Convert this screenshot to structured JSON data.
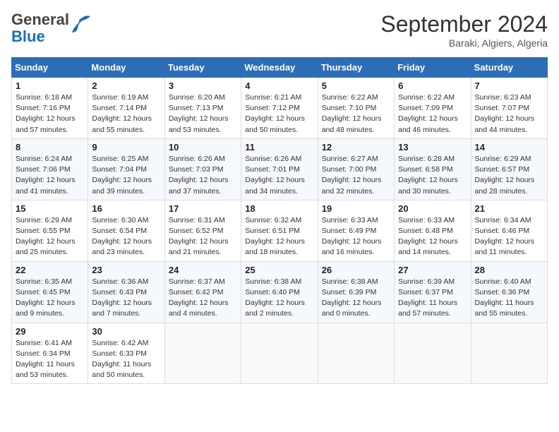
{
  "header": {
    "logo_general": "General",
    "logo_blue": "Blue",
    "month": "September 2024",
    "location": "Baraki, Algiers, Algeria"
  },
  "days_of_week": [
    "Sunday",
    "Monday",
    "Tuesday",
    "Wednesday",
    "Thursday",
    "Friday",
    "Saturday"
  ],
  "weeks": [
    [
      {
        "day": "1",
        "sunrise": "6:18 AM",
        "sunset": "7:16 PM",
        "daylight": "12 hours and 57 minutes."
      },
      {
        "day": "2",
        "sunrise": "6:19 AM",
        "sunset": "7:14 PM",
        "daylight": "12 hours and 55 minutes."
      },
      {
        "day": "3",
        "sunrise": "6:20 AM",
        "sunset": "7:13 PM",
        "daylight": "12 hours and 53 minutes."
      },
      {
        "day": "4",
        "sunrise": "6:21 AM",
        "sunset": "7:12 PM",
        "daylight": "12 hours and 50 minutes."
      },
      {
        "day": "5",
        "sunrise": "6:22 AM",
        "sunset": "7:10 PM",
        "daylight": "12 hours and 48 minutes."
      },
      {
        "day": "6",
        "sunrise": "6:22 AM",
        "sunset": "7:09 PM",
        "daylight": "12 hours and 46 minutes."
      },
      {
        "day": "7",
        "sunrise": "6:23 AM",
        "sunset": "7:07 PM",
        "daylight": "12 hours and 44 minutes."
      }
    ],
    [
      {
        "day": "8",
        "sunrise": "6:24 AM",
        "sunset": "7:06 PM",
        "daylight": "12 hours and 41 minutes."
      },
      {
        "day": "9",
        "sunrise": "6:25 AM",
        "sunset": "7:04 PM",
        "daylight": "12 hours and 39 minutes."
      },
      {
        "day": "10",
        "sunrise": "6:26 AM",
        "sunset": "7:03 PM",
        "daylight": "12 hours and 37 minutes."
      },
      {
        "day": "11",
        "sunrise": "6:26 AM",
        "sunset": "7:01 PM",
        "daylight": "12 hours and 34 minutes."
      },
      {
        "day": "12",
        "sunrise": "6:27 AM",
        "sunset": "7:00 PM",
        "daylight": "12 hours and 32 minutes."
      },
      {
        "day": "13",
        "sunrise": "6:28 AM",
        "sunset": "6:58 PM",
        "daylight": "12 hours and 30 minutes."
      },
      {
        "day": "14",
        "sunrise": "6:29 AM",
        "sunset": "6:57 PM",
        "daylight": "12 hours and 28 minutes."
      }
    ],
    [
      {
        "day": "15",
        "sunrise": "6:29 AM",
        "sunset": "6:55 PM",
        "daylight": "12 hours and 25 minutes."
      },
      {
        "day": "16",
        "sunrise": "6:30 AM",
        "sunset": "6:54 PM",
        "daylight": "12 hours and 23 minutes."
      },
      {
        "day": "17",
        "sunrise": "6:31 AM",
        "sunset": "6:52 PM",
        "daylight": "12 hours and 21 minutes."
      },
      {
        "day": "18",
        "sunrise": "6:32 AM",
        "sunset": "6:51 PM",
        "daylight": "12 hours and 18 minutes."
      },
      {
        "day": "19",
        "sunrise": "6:33 AM",
        "sunset": "6:49 PM",
        "daylight": "12 hours and 16 minutes."
      },
      {
        "day": "20",
        "sunrise": "6:33 AM",
        "sunset": "6:48 PM",
        "daylight": "12 hours and 14 minutes."
      },
      {
        "day": "21",
        "sunrise": "6:34 AM",
        "sunset": "6:46 PM",
        "daylight": "12 hours and 11 minutes."
      }
    ],
    [
      {
        "day": "22",
        "sunrise": "6:35 AM",
        "sunset": "6:45 PM",
        "daylight": "12 hours and 9 minutes."
      },
      {
        "day": "23",
        "sunrise": "6:36 AM",
        "sunset": "6:43 PM",
        "daylight": "12 hours and 7 minutes."
      },
      {
        "day": "24",
        "sunrise": "6:37 AM",
        "sunset": "6:42 PM",
        "daylight": "12 hours and 4 minutes."
      },
      {
        "day": "25",
        "sunrise": "6:38 AM",
        "sunset": "6:40 PM",
        "daylight": "12 hours and 2 minutes."
      },
      {
        "day": "26",
        "sunrise": "6:38 AM",
        "sunset": "6:39 PM",
        "daylight": "12 hours and 0 minutes."
      },
      {
        "day": "27",
        "sunrise": "6:39 AM",
        "sunset": "6:37 PM",
        "daylight": "11 hours and 57 minutes."
      },
      {
        "day": "28",
        "sunrise": "6:40 AM",
        "sunset": "6:36 PM",
        "daylight": "11 hours and 55 minutes."
      }
    ],
    [
      {
        "day": "29",
        "sunrise": "6:41 AM",
        "sunset": "6:34 PM",
        "daylight": "11 hours and 53 minutes."
      },
      {
        "day": "30",
        "sunrise": "6:42 AM",
        "sunset": "6:33 PM",
        "daylight": "11 hours and 50 minutes."
      },
      null,
      null,
      null,
      null,
      null
    ]
  ]
}
